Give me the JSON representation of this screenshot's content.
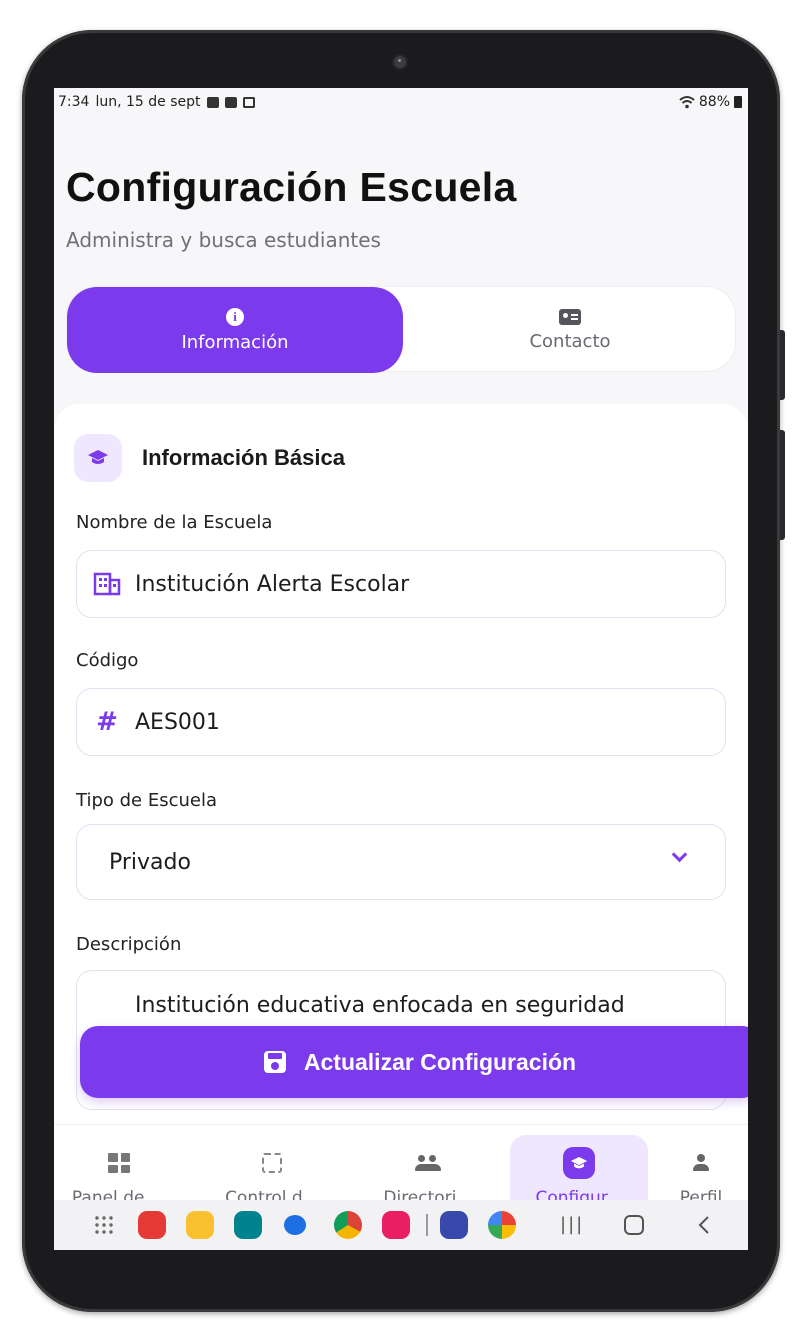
{
  "status_bar": {
    "time": "7:34",
    "date": "lun, 15 de sept",
    "battery": "88%"
  },
  "header": {
    "title": "Configuración Escuela",
    "subtitle": "Administra y busca estudiantes"
  },
  "tabs": [
    {
      "label": "Información",
      "icon": "info-icon",
      "active": true
    },
    {
      "label": "Contacto",
      "icon": "contact-card-icon",
      "active": false
    }
  ],
  "section": {
    "title": "Información Básica",
    "icon": "graduation-cap-icon"
  },
  "form": {
    "school_name": {
      "label": "Nombre de la Escuela",
      "value": "Institución Alerta Escolar",
      "icon": "building-icon"
    },
    "code": {
      "label": "Código",
      "value": "AES001",
      "icon": "hash-icon",
      "glyph": "#"
    },
    "school_type": {
      "label": "Tipo de Escuela",
      "value": "Privado"
    },
    "description": {
      "label": "Descripción",
      "value": "Institución educativa enfocada en seguridad"
    }
  },
  "actions": {
    "update_label": "Actualizar Configuración"
  },
  "bottom_nav": [
    {
      "label": "Panel de ...",
      "icon": "dashboard-icon",
      "active": false
    },
    {
      "label": "Control d...",
      "icon": "qr-scan-icon",
      "active": false
    },
    {
      "label": "Directori...",
      "icon": "people-icon",
      "active": false
    },
    {
      "label": "Configur...",
      "icon": "graduation-cap-icon",
      "active": true
    },
    {
      "label": "Perfil",
      "icon": "person-icon",
      "active": false
    }
  ],
  "colors": {
    "accent": "#7c3aed",
    "accent_light": "#efe7fd",
    "background": "#f7f7f9"
  }
}
